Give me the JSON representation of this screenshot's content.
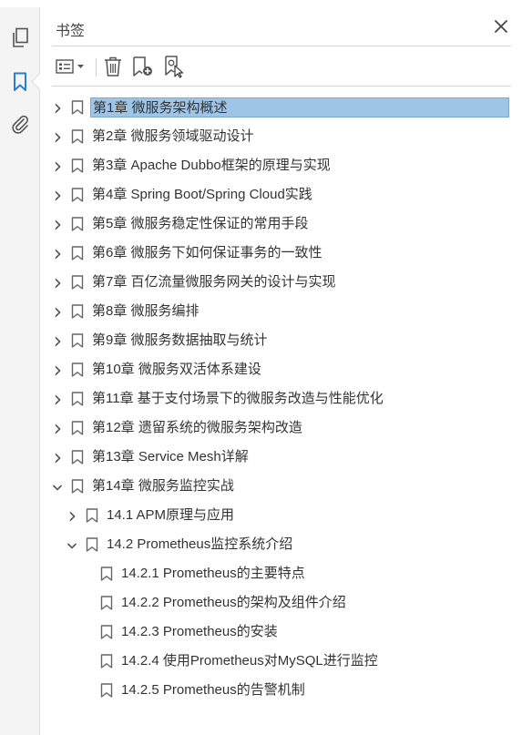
{
  "panel": {
    "title": "书签"
  },
  "icons": {
    "rail": [
      "pages-icon",
      "bookmark-icon",
      "attachment-icon"
    ],
    "toolbar": [
      "options-menu-icon",
      "delete-bookmark-icon",
      "new-bookmark-icon",
      "bookmark-from-selection-icon"
    ],
    "close": "close-icon"
  },
  "colors": {
    "accent": "#2a7ed2",
    "selection": "#9ec5e6"
  },
  "bookmarks": [
    {
      "label": "第1章 微服务架构概述",
      "level": 0,
      "state": "collapsed",
      "selected": true
    },
    {
      "label": "第2章 微服务领域驱动设计",
      "level": 0,
      "state": "collapsed"
    },
    {
      "label": "第3章 Apache Dubbo框架的原理与实现",
      "level": 0,
      "state": "collapsed"
    },
    {
      "label": "第4章 Spring Boot/Spring Cloud实践",
      "level": 0,
      "state": "collapsed"
    },
    {
      "label": "第5章 微服务稳定性保证的常用手段",
      "level": 0,
      "state": "collapsed"
    },
    {
      "label": "第6章 微服务下如何保证事务的一致性",
      "level": 0,
      "state": "collapsed"
    },
    {
      "label": "第7章 百亿流量微服务网关的设计与实现",
      "level": 0,
      "state": "collapsed"
    },
    {
      "label": "第8章 微服务编排",
      "level": 0,
      "state": "collapsed"
    },
    {
      "label": "第9章 微服务数据抽取与统计",
      "level": 0,
      "state": "collapsed"
    },
    {
      "label": "第10章 微服务双活体系建设",
      "level": 0,
      "state": "collapsed"
    },
    {
      "label": "第11章 基于支付场景下的微服务改造与性能优化",
      "level": 0,
      "state": "collapsed"
    },
    {
      "label": "第12章 遗留系统的微服务架构改造",
      "level": 0,
      "state": "collapsed"
    },
    {
      "label": "第13章 Service Mesh详解",
      "level": 0,
      "state": "collapsed"
    },
    {
      "label": "第14章 微服务监控实战",
      "level": 0,
      "state": "expanded"
    },
    {
      "label": "14.1 APM原理与应用",
      "level": 1,
      "state": "collapsed"
    },
    {
      "label": "14.2 Prometheus监控系统介绍",
      "level": 1,
      "state": "expanded"
    },
    {
      "label": "14.2.1 Prometheus的主要特点",
      "level": 2,
      "state": "leaf"
    },
    {
      "label": "14.2.2 Prometheus的架构及组件介绍",
      "level": 2,
      "state": "leaf"
    },
    {
      "label": "14.2.3 Prometheus的安装",
      "level": 2,
      "state": "leaf"
    },
    {
      "label": "14.2.4 使用Prometheus对MySQL进行监控",
      "level": 2,
      "state": "leaf"
    },
    {
      "label": "14.2.5 Prometheus的告警机制",
      "level": 2,
      "state": "leaf"
    }
  ]
}
